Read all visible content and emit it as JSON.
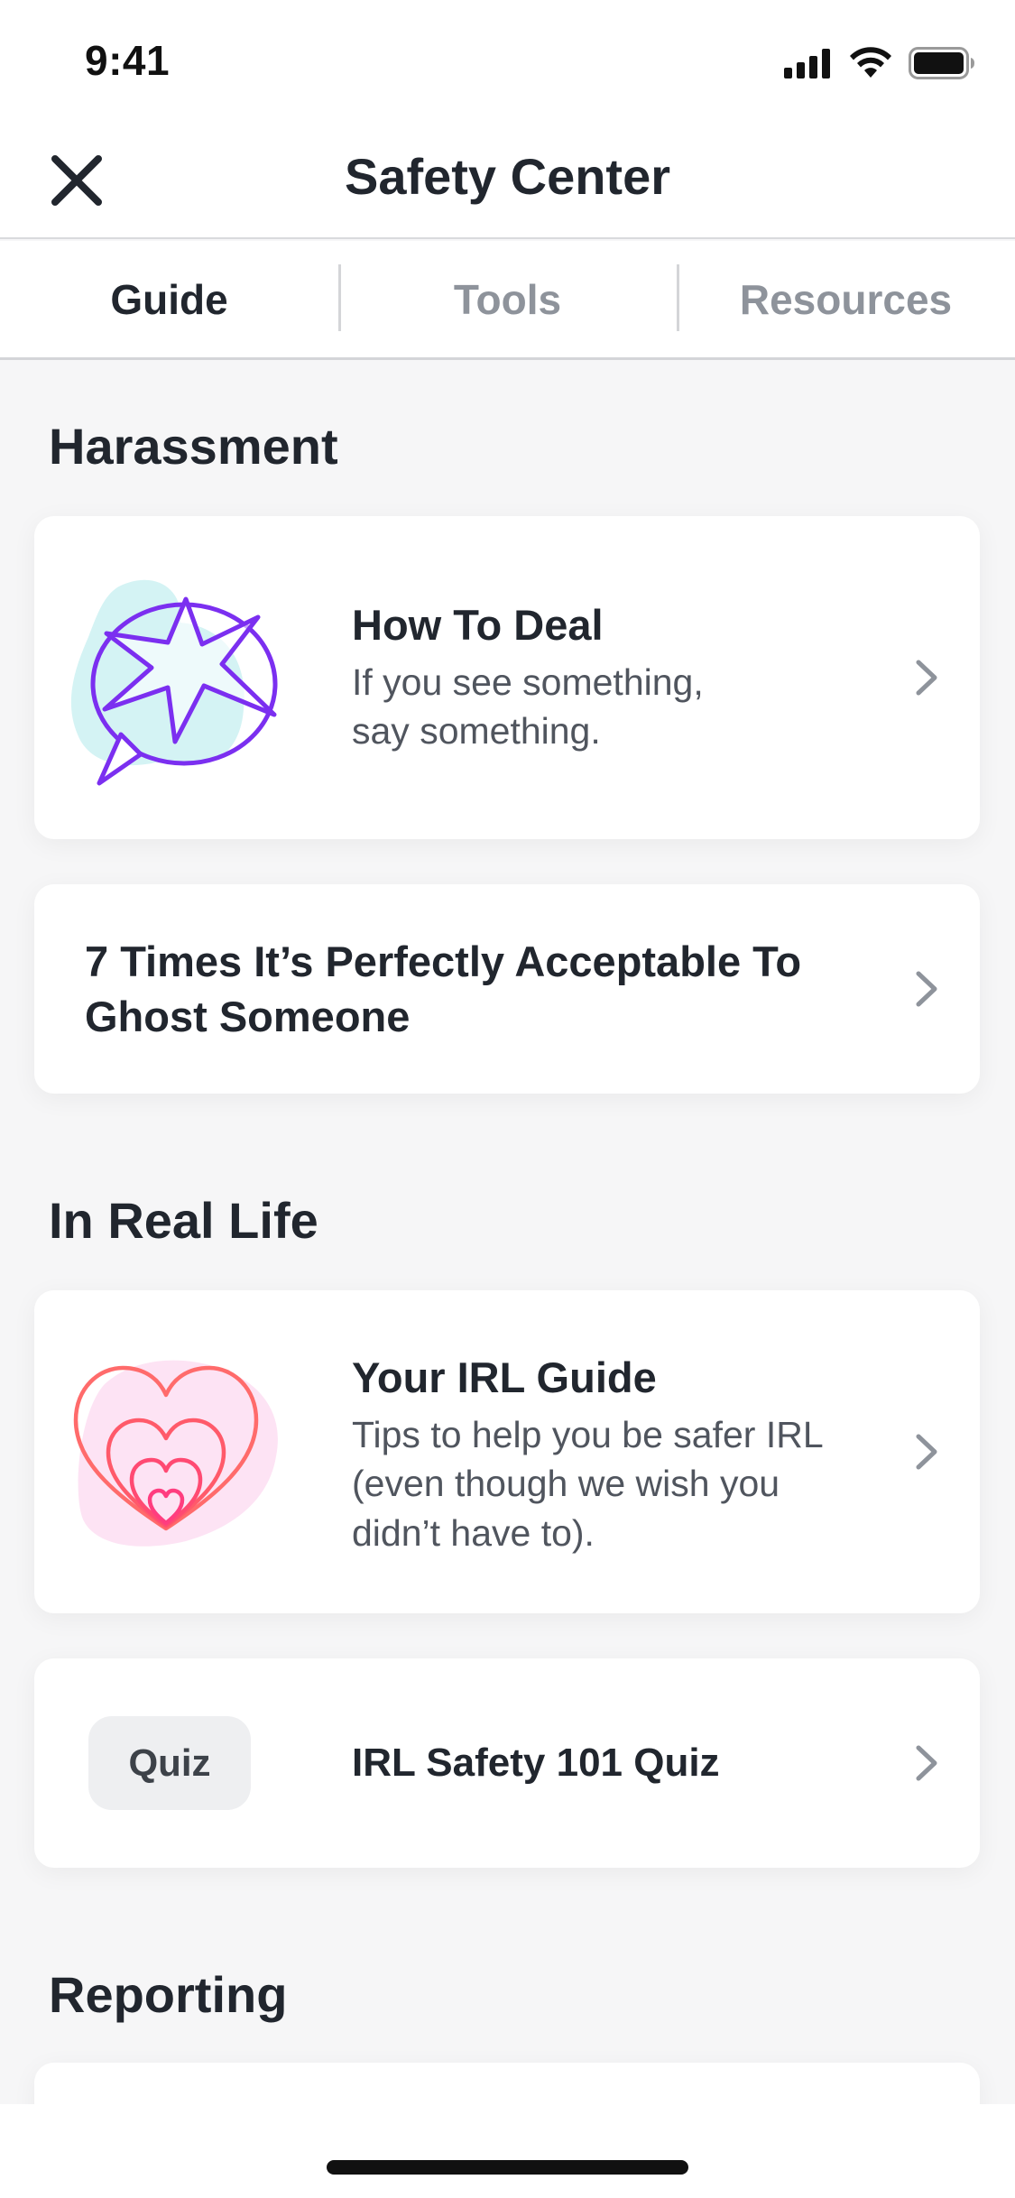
{
  "status_bar": {
    "time": "9:41"
  },
  "header": {
    "title": "Safety Center"
  },
  "tabs": [
    {
      "label": "Guide",
      "active": true
    },
    {
      "label": "Tools",
      "active": false
    },
    {
      "label": "Resources",
      "active": false
    }
  ],
  "sections": {
    "harassment": {
      "title": "Harassment",
      "cards": [
        {
          "title": "How To Deal",
          "subtitle_line1": "If you see something,",
          "subtitle_line2": "say something."
        },
        {
          "title_line1": "7 Times It’s Perfectly Acceptable To",
          "title_line2": "Ghost Someone"
        }
      ]
    },
    "in_real_life": {
      "title": "In Real Life",
      "cards": [
        {
          "title": "Your IRL Guide",
          "subtitle_line1": "Tips to help you be safer IRL",
          "subtitle_line2": "(even though we wish you",
          "subtitle_line3": "didn’t have to)."
        },
        {
          "badge": "Quiz",
          "title": "IRL Safety 101 Quiz"
        }
      ]
    },
    "reporting": {
      "title": "Reporting"
    }
  },
  "icons": {
    "close": "close-icon",
    "chevron": "chevron-right-icon",
    "harassment_illustration": "speech-bubble-star-icon",
    "irl_illustration": "nested-hearts-icon"
  },
  "colors": {
    "text_primary": "#21262e",
    "text_secondary": "#50555e",
    "tab_inactive": "#8e939b",
    "illustration_purple": "#7b2ff0",
    "illustration_teal": "#d4f3f4",
    "heart_red": "#ff4458",
    "heart_pink_bg": "#fde3f4"
  }
}
